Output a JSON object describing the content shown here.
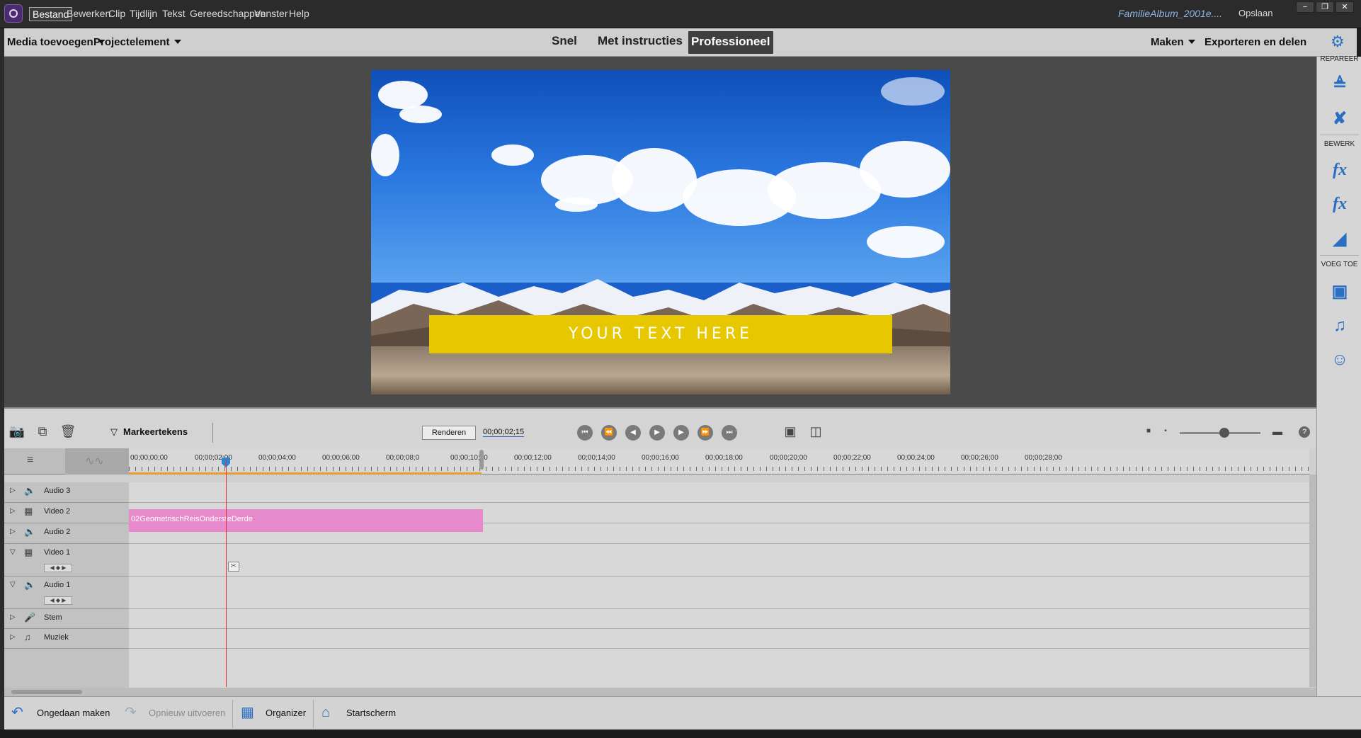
{
  "menubar": {
    "items": [
      "Bestand",
      "Bewerken",
      "Clip",
      "Tijdlijn",
      "Tekst",
      "Gereedschappen",
      "Venster",
      "Help"
    ],
    "active": "Bestand",
    "document": "FamilieAlbum_2001e....",
    "save": "Opslaan",
    "window_buttons": [
      "−",
      "❐",
      "✕"
    ]
  },
  "toolbar": {
    "add_media": "Media toevoegen",
    "project_asset": "Projectelement",
    "modes": [
      "Snel",
      "Met instructies",
      "Professioneel"
    ],
    "active_mode": "Professioneel",
    "create": "Maken",
    "export": "Exporteren en delen"
  },
  "preview": {
    "overlay_text": "YOUR TEXT HERE"
  },
  "right_panel": {
    "sections": [
      "REPAREER",
      "BEWERK",
      "VOEG TOE"
    ]
  },
  "timeline_toolbar": {
    "markers_label": "Markeertekens",
    "render_label": "Renderen",
    "timecode": "00;00;02;15",
    "help": "?"
  },
  "ruler": {
    "ticks": [
      "00;00;00;00",
      "00;00;02;00",
      "00;00;04;00",
      "00;00;06;00",
      "00;00;08;0",
      "00;00;10;00",
      "00;00;12;00",
      "00;00;14;00",
      "00;00;16;00",
      "00;00;18;00",
      "00;00;20;00",
      "00;00;22;00",
      "00;00;24;00",
      "00;00;26;00",
      "00;00;28;00"
    ]
  },
  "tracks": [
    {
      "name": "Audio 3",
      "type": "audio",
      "expanded": false
    },
    {
      "name": "Video 2",
      "type": "video",
      "expanded": false
    },
    {
      "name": "Audio 2",
      "type": "audio",
      "expanded": false
    },
    {
      "name": "Video 1",
      "type": "video",
      "expanded": true
    },
    {
      "name": "Audio 1",
      "type": "audio",
      "expanded": true
    },
    {
      "name": "Stem",
      "type": "voice",
      "expanded": false
    },
    {
      "name": "Muziek",
      "type": "music",
      "expanded": false
    }
  ],
  "clip": {
    "name": "02GeometrischReisOndersteDerde",
    "track": "Video 2",
    "color": "#e68acb"
  },
  "bottombar": {
    "undo": "Ongedaan maken",
    "redo": "Opnieuw uitvoeren",
    "organizer": "Organizer",
    "home": "Startscherm"
  },
  "colors": {
    "accent": "#2b6fc4",
    "clip": "#e68acb",
    "title_bar": "#e6c700",
    "playhead": "#e03232",
    "work_area": "#e69b30"
  }
}
